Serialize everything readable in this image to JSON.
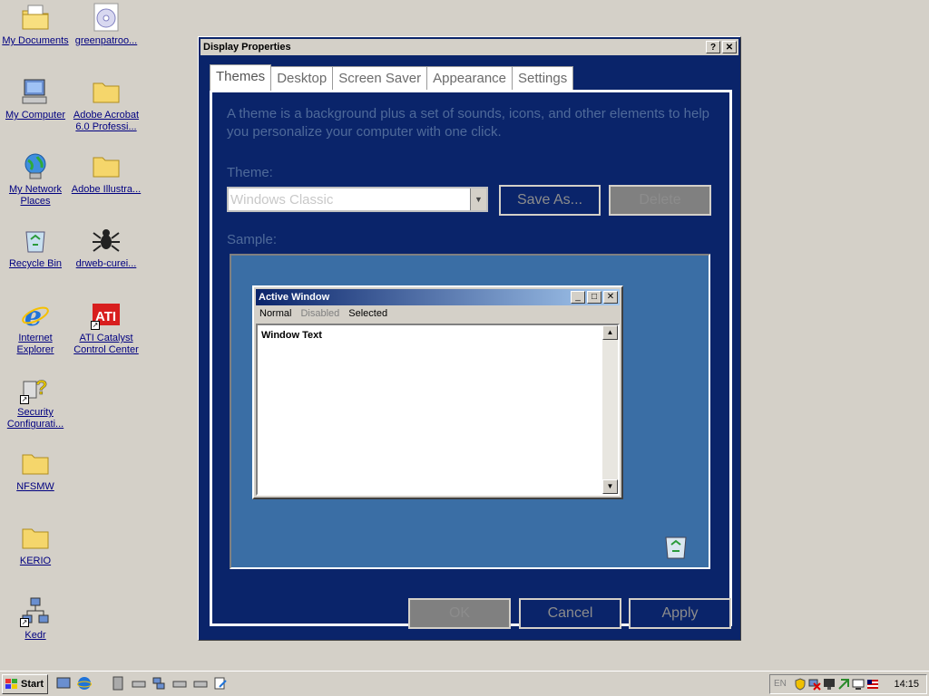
{
  "desktop": {
    "icons": [
      {
        "label": "My Documents",
        "icon": "folder-documents-icon"
      },
      {
        "label": "greenpatroo...",
        "icon": "cd-disc-icon"
      },
      {
        "label": "My Computer",
        "icon": "computer-icon"
      },
      {
        "label": "Adobe Acrobat 6.0 Professi...",
        "icon": "folder-icon"
      },
      {
        "label": "My Network Places",
        "icon": "network-places-icon"
      },
      {
        "label": "Adobe Illustra...",
        "icon": "folder-icon"
      },
      {
        "label": "Recycle Bin",
        "icon": "recycle-bin-icon"
      },
      {
        "label": "drweb-curei...",
        "icon": "spider-icon"
      },
      {
        "label": "Internet Explorer",
        "icon": "internet-explorer-icon"
      },
      {
        "label": "ATI Catalyst Control Center",
        "icon": "ati-icon"
      },
      {
        "label": "Security Configurati...",
        "icon": "security-config-icon"
      },
      {
        "label": "NFSMW",
        "icon": "folder-icon"
      },
      {
        "label": "KERIO",
        "icon": "folder-icon"
      },
      {
        "label": "Kedr",
        "icon": "network-shortcut-icon"
      }
    ]
  },
  "dialog": {
    "title": "Display Properties",
    "help_btn": "?",
    "close_btn": "✕",
    "tabs": [
      "Themes",
      "Desktop",
      "Screen Saver",
      "Appearance",
      "Settings"
    ],
    "description": "A theme is a background plus a set of sounds, icons, and other elements to help you personalize your computer with one click.",
    "theme_label": "Theme:",
    "theme_value": "Windows Classic",
    "save_as": "Save As...",
    "delete": "Delete",
    "sample_label": "Sample:",
    "sample": {
      "title": "Active Window",
      "menu": [
        "Normal",
        "Disabled",
        "Selected"
      ],
      "body": "Window Text"
    },
    "ok": "OK",
    "cancel": "Cancel",
    "apply": "Apply"
  },
  "taskbar": {
    "start": "Start",
    "lang": "EN",
    "clock": "14:15"
  },
  "colors": {
    "desktop": "#d4d0c8",
    "dialog_bg": "#0a246a",
    "sample_bg": "#3a6ea5"
  }
}
